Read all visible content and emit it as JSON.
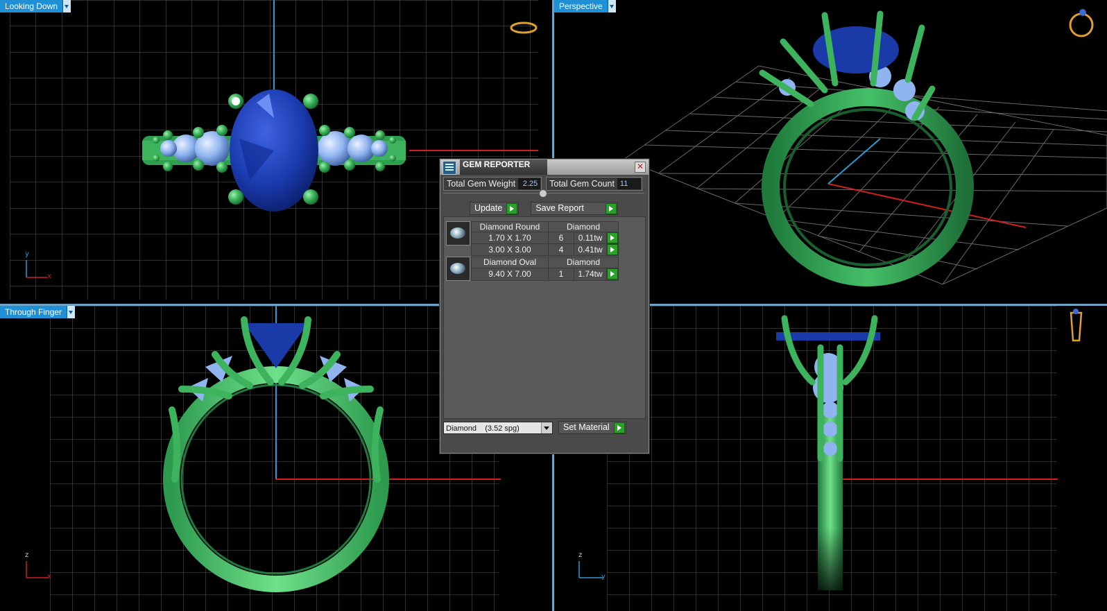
{
  "viewports": {
    "top_left": {
      "label": "Looking Down"
    },
    "top_right": {
      "label": "Perspective"
    },
    "bottom_left": {
      "label": "Through Finger"
    },
    "bottom_right": {
      "label": ""
    }
  },
  "axes": {
    "top_left": {
      "vertical": "y",
      "horizontal": "x"
    },
    "bottom_left": {
      "vertical": "z",
      "horizontal": "x"
    },
    "bottom_right": {
      "vertical": "z",
      "horizontal": "y"
    }
  },
  "gem_reporter": {
    "title": "GEM REPORTER",
    "close_glyph": "✕",
    "total_weight_label": "Total Gem Weight",
    "total_weight_value": "2.25",
    "total_count_label": "Total Gem Count",
    "total_count_value": "11",
    "update_label": "Update",
    "save_report_label": "Save Report",
    "groups": [
      {
        "name": "Diamond Round",
        "material": "Diamond",
        "rows": [
          {
            "size": "1.70 X 1.70",
            "count": "6",
            "weight": "0.11tw"
          },
          {
            "size": "3.00 X 3.00",
            "count": "4",
            "weight": "0.41tw"
          }
        ]
      },
      {
        "name": "Diamond Oval",
        "material": "Diamond",
        "rows": [
          {
            "size": "9.40 X 7.00",
            "count": "1",
            "weight": "1.74tw"
          }
        ]
      }
    ],
    "material_select_value": "Diamond    (3.52 spg)",
    "set_material_label": "Set Material"
  },
  "colors": {
    "metal": "#3cb35c",
    "center_stone": "#1a3aa8",
    "side_stones": "#8fb4f0",
    "grid": "#6a6a6a",
    "axis_blue": "#2a9bd0",
    "axis_red": "#d02020",
    "viewport_label": "#1f8fd6"
  }
}
